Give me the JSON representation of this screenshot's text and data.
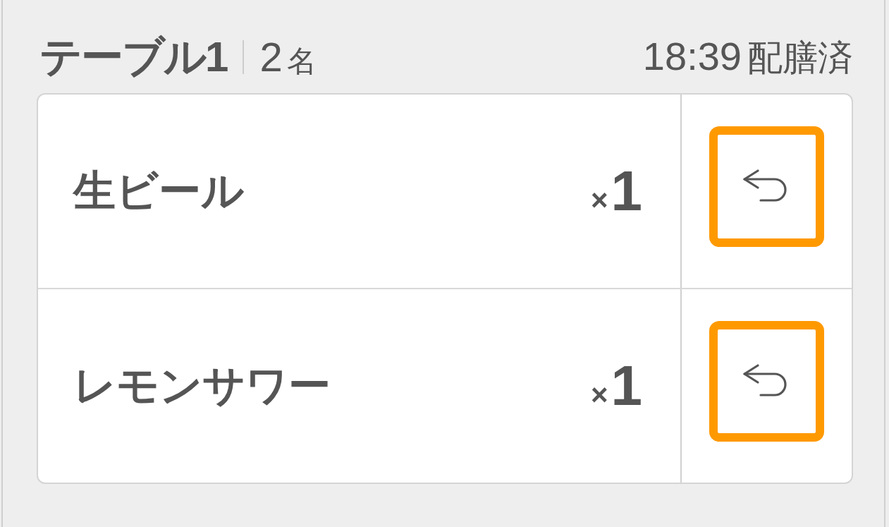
{
  "table": {
    "name": "テーブル1",
    "guests": "2",
    "guests_unit": "名",
    "time": "18:39",
    "status": "配膳済"
  },
  "items": [
    {
      "name": "生ビール",
      "times_sign": "×",
      "quantity": "1"
    },
    {
      "name": "レモンサワー",
      "times_sign": "×",
      "quantity": "1"
    }
  ]
}
